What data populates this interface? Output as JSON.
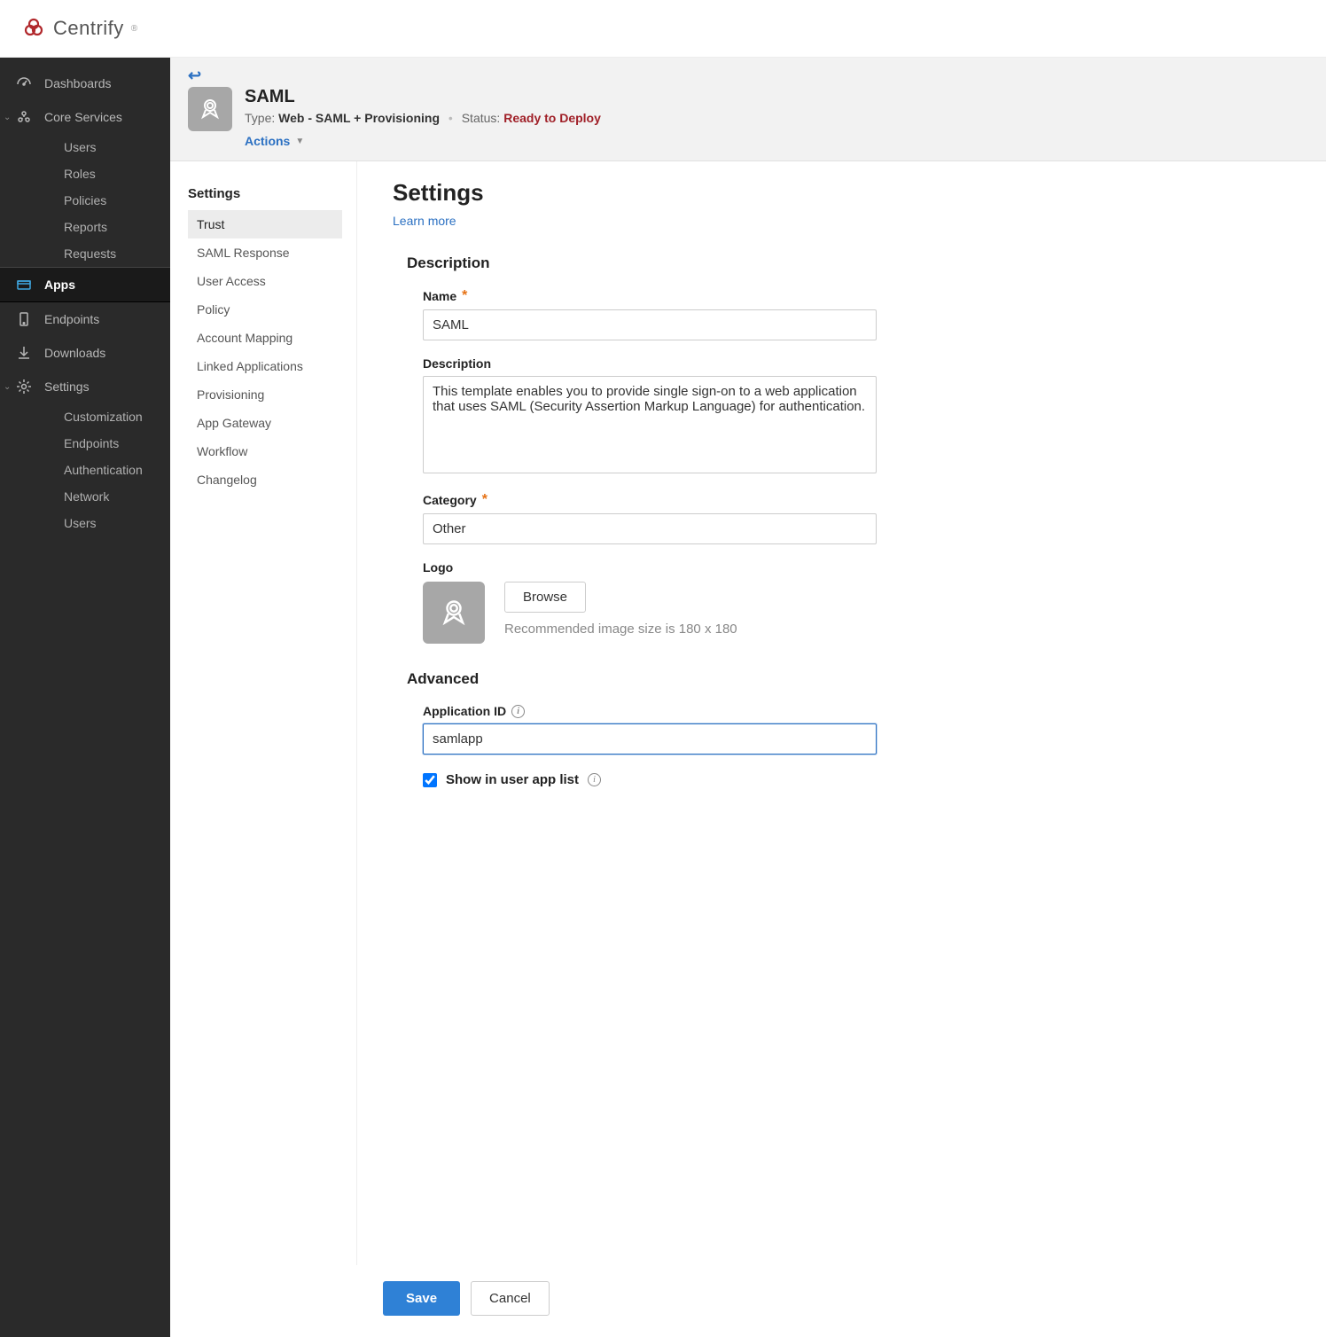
{
  "brand": "Centrify",
  "sidebar": {
    "items": [
      {
        "label": "Dashboards",
        "icon": "dashboard"
      },
      {
        "label": "Core Services",
        "icon": "core",
        "expanded": true,
        "children": [
          "Users",
          "Roles",
          "Policies",
          "Reports",
          "Requests"
        ]
      },
      {
        "label": "Apps",
        "icon": "apps",
        "active": true
      },
      {
        "label": "Endpoints",
        "icon": "endpoint"
      },
      {
        "label": "Downloads",
        "icon": "download"
      },
      {
        "label": "Settings",
        "icon": "gear",
        "expanded": true,
        "children": [
          "Customization",
          "Endpoints",
          "Authentication",
          "Network",
          "Users"
        ]
      }
    ]
  },
  "header": {
    "title": "SAML",
    "type_label": "Type:",
    "type_value": "Web - SAML + Provisioning",
    "status_label": "Status:",
    "status_value": "Ready to Deploy",
    "actions": "Actions"
  },
  "subnav": {
    "title": "Settings",
    "items": [
      "Trust",
      "SAML Response",
      "User Access",
      "Policy",
      "Account Mapping",
      "Linked Applications",
      "Provisioning",
      "App Gateway",
      "Workflow",
      "Changelog"
    ],
    "selected": "Trust"
  },
  "form": {
    "heading": "Settings",
    "learn_more": "Learn more",
    "section_description": "Description",
    "name_label": "Name",
    "name_value": "SAML",
    "description_label": "Description",
    "description_value": "This template enables you to provide single sign-on to a web application that uses SAML (Security Assertion Markup Language) for authentication.",
    "category_label": "Category",
    "category_value": "Other",
    "logo_label": "Logo",
    "browse_label": "Browse",
    "logo_hint": "Recommended image size is 180 x 180",
    "section_advanced": "Advanced",
    "appid_label": "Application ID",
    "appid_value": "samlapp",
    "show_in_list_label": "Show in user app list",
    "show_in_list_checked": true
  },
  "footer": {
    "save": "Save",
    "cancel": "Cancel"
  }
}
